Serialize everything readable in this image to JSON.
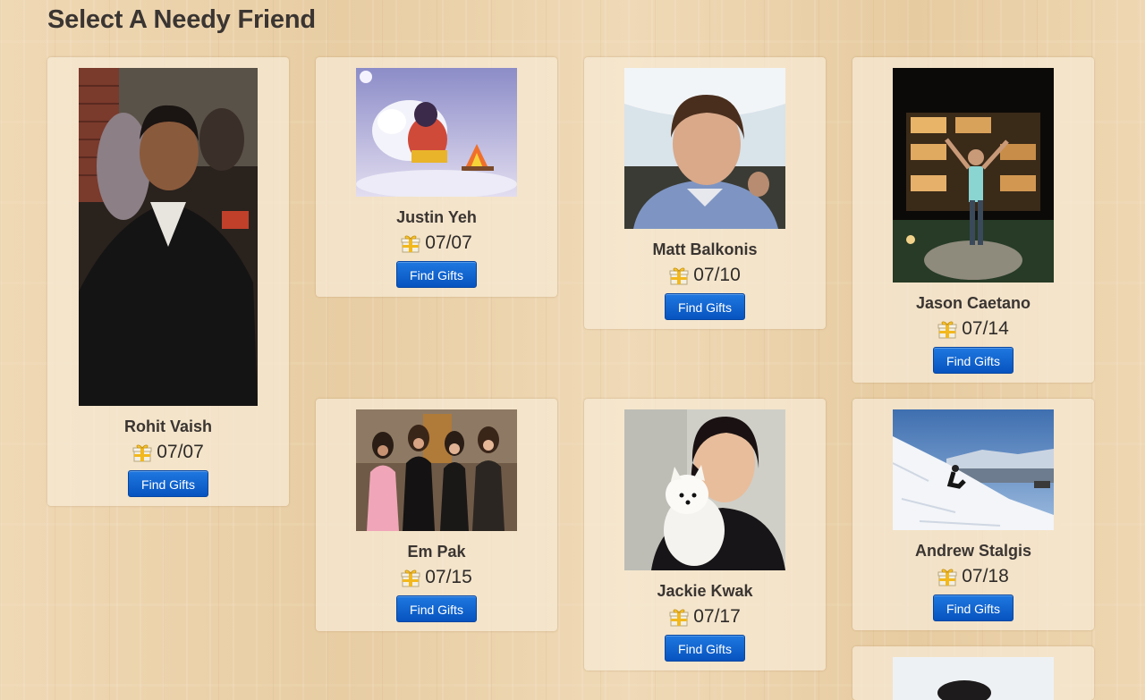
{
  "page": {
    "title": "Select A Needy Friend"
  },
  "friends": [
    {
      "name": "Rohit Vaish",
      "date": "07/07",
      "button": "Find Gifts"
    },
    {
      "name": "Justin Yeh",
      "date": "07/07",
      "button": "Find Gifts"
    },
    {
      "name": "Matt Balkonis",
      "date": "07/10",
      "button": "Find Gifts"
    },
    {
      "name": "Jason Caetano",
      "date": "07/14",
      "button": "Find Gifts"
    },
    {
      "name": "Em Pak",
      "date": "07/15",
      "button": "Find Gifts"
    },
    {
      "name": "Jackie Kwak",
      "date": "07/17",
      "button": "Find Gifts"
    },
    {
      "name": "Andrew Stalgis",
      "date": "07/18",
      "button": "Find Gifts"
    }
  ],
  "icons": {
    "birthday": "gift-icon"
  },
  "colors": {
    "button": "#0a63d0",
    "background": "#ecd5b0"
  }
}
